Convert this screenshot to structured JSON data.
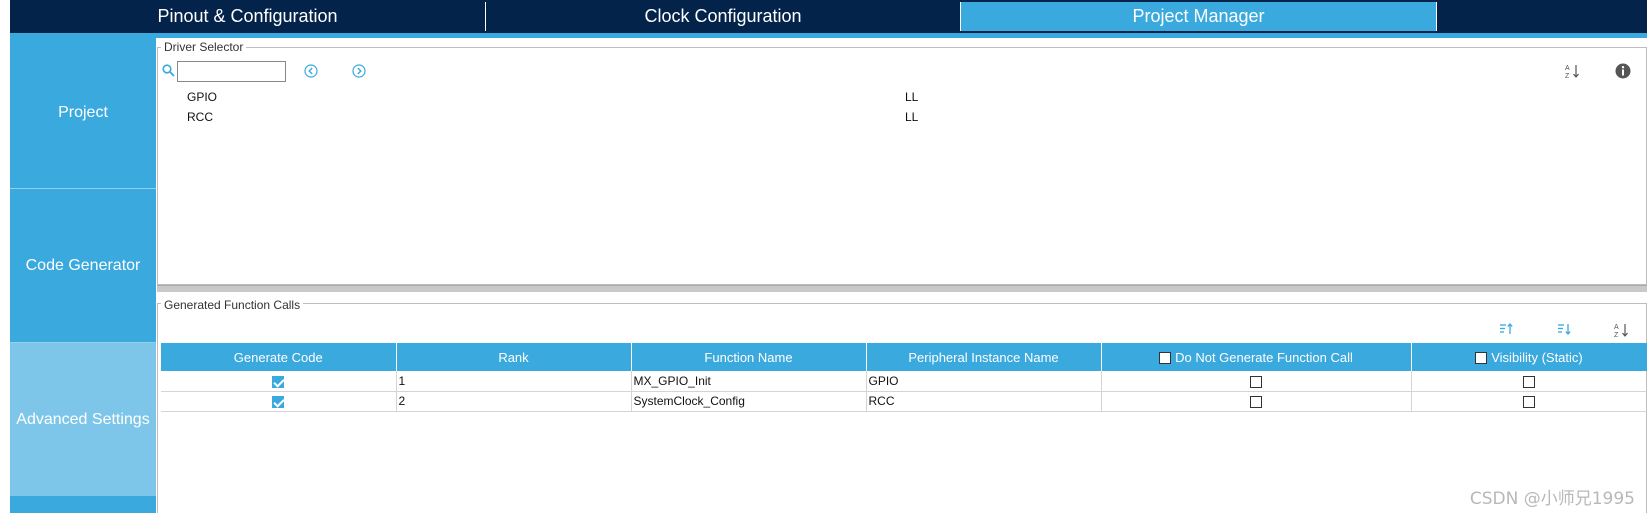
{
  "tabs": [
    {
      "label": "Pinout & Configuration",
      "active": false
    },
    {
      "label": "Clock Configuration",
      "active": false
    },
    {
      "label": "Project Manager",
      "active": true
    }
  ],
  "sidebar": {
    "items": [
      {
        "label": "Project",
        "selected": false
      },
      {
        "label": "Code Generator",
        "selected": false
      },
      {
        "label": "Advanced Settings",
        "selected": true
      }
    ]
  },
  "driver_selector": {
    "title": "Driver Selector",
    "search_value": "",
    "rows": [
      {
        "name": "GPIO",
        "driver": "LL"
      },
      {
        "name": "RCC",
        "driver": "LL"
      }
    ]
  },
  "function_calls": {
    "title": "Generated Function Calls",
    "columns": [
      "Generate Code",
      "Rank",
      "Function Name",
      "Peripheral Instance Name",
      "Do Not Generate Function Call",
      "Visibility (Static)"
    ],
    "rows": [
      {
        "generate": true,
        "rank": "1",
        "function": "MX_GPIO_Init",
        "instance": "GPIO",
        "do_not_generate": false,
        "static": false
      },
      {
        "generate": true,
        "rank": "2",
        "function": "SystemClock_Config",
        "instance": "RCC",
        "do_not_generate": false,
        "static": false
      }
    ]
  },
  "watermark": "CSDN @小师兄1995",
  "colors": {
    "accent": "#3aa9de",
    "navy": "#03234b",
    "selected_nav": "#7dc6e9"
  }
}
